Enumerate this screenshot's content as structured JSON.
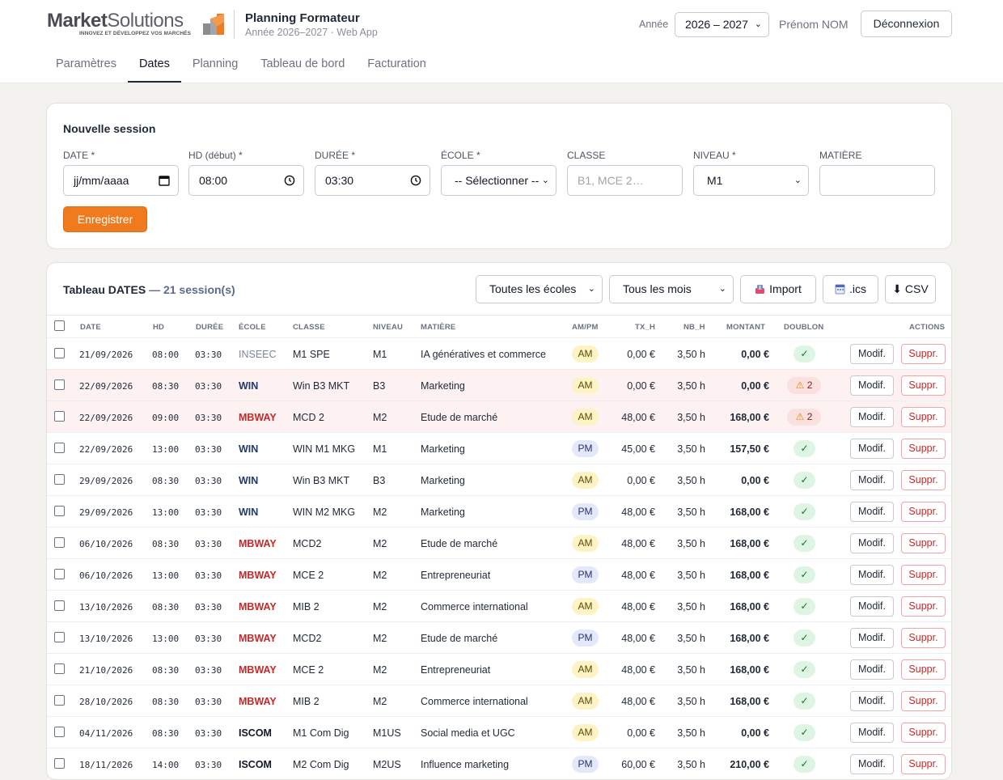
{
  "brand": {
    "logo_part1": "Market",
    "logo_part2": "Solutions",
    "logo_tagline": "INNOVEZ ET DÉVELOPPEZ VOS MARCHÉS",
    "app_title": "Planning Formateur",
    "app_subtitle": "Année 2026–2027 · Web App",
    "colors": {
      "accent": "#f07a1e",
      "logo_grey": "#5f6166"
    }
  },
  "header": {
    "year_label": "Année",
    "year_value": "2026 – 2027",
    "user_name": "Prénom NOM",
    "logout_label": "Déconnexion"
  },
  "nav": {
    "tabs": [
      {
        "label": "Paramètres",
        "active": false
      },
      {
        "label": "Dates",
        "active": true
      },
      {
        "label": "Planning",
        "active": false
      },
      {
        "label": "Tableau de bord",
        "active": false
      },
      {
        "label": "Facturation",
        "active": false
      }
    ]
  },
  "form": {
    "title": "Nouvelle session",
    "fields": {
      "date": {
        "label": "DATE *",
        "placeholder": "jj/mm/aaaa",
        "icon": "calendar-icon"
      },
      "hd": {
        "label": "HD (début) *",
        "value": "08:00",
        "icon": "clock-icon"
      },
      "duree": {
        "label": "DURÉE *",
        "value": "03:30",
        "icon": "clock-icon"
      },
      "ecole": {
        "label": "ÉCOLE *",
        "value": "-- Sélectionner --"
      },
      "classe": {
        "label": "CLASSE",
        "placeholder": "B1, MCE 2…"
      },
      "niveau": {
        "label": "NIVEAU *",
        "value": "M1"
      },
      "matiere": {
        "label": "MATIÈRE",
        "value": ""
      }
    },
    "save_label": "Enregistrer"
  },
  "table": {
    "title": "Tableau DATES",
    "count_label": "— 21 session(s)",
    "filters": {
      "ecoles": "Toutes les écoles",
      "mois": "Tous les mois"
    },
    "tools": {
      "import_label": "Import",
      "ics_label": ".ics",
      "csv_label": "CSV",
      "csv_prefix": "⬇"
    },
    "columns": [
      "DATE",
      "HD",
      "DURÉE",
      "ÉCOLE",
      "CLASSE",
      "NIVEAU",
      "MATIÈRE",
      "AM/PM",
      "TX_H",
      "NB_H",
      "MONTANT",
      "DOUBLON",
      "ACTIONS"
    ],
    "edit_label": "Modif.",
    "delete_label": "Suppr.",
    "ok_symbol": "✓",
    "warn_symbol": "⚠",
    "school_colors": {
      "INSEEC": "#7a8699",
      "WIN": "#1e3a6e",
      "MBWAY": "#c62828",
      "ISCOM": "#111827"
    },
    "rows": [
      {
        "date": "21/09/2026",
        "hd": "08:00",
        "duree": "03:30",
        "ecole": "INSEEC",
        "classe": "M1 SPE",
        "niveau": "M1",
        "matiere": "IA génératives et commerce",
        "ampm": "AM",
        "tx_h": "0,00 €",
        "nb_h": "3,50 h",
        "montant": "0,00 €",
        "doublon": "",
        "dup": false
      },
      {
        "date": "22/09/2026",
        "hd": "08:30",
        "duree": "03:30",
        "ecole": "WIN",
        "classe": "Win B3 MKT",
        "niveau": "B3",
        "matiere": "Marketing",
        "ampm": "AM",
        "tx_h": "0,00 €",
        "nb_h": "3,50 h",
        "montant": "0,00 €",
        "doublon": "2",
        "dup": true
      },
      {
        "date": "22/09/2026",
        "hd": "09:00",
        "duree": "03:30",
        "ecole": "MBWAY",
        "classe": "MCD 2",
        "niveau": "M2",
        "matiere": "Etude de marché",
        "ampm": "AM",
        "tx_h": "48,00 €",
        "nb_h": "3,50 h",
        "montant": "168,00 €",
        "doublon": "2",
        "dup": true
      },
      {
        "date": "22/09/2026",
        "hd": "13:00",
        "duree": "03:30",
        "ecole": "WIN",
        "classe": "WIN M1 MKG",
        "niveau": "M1",
        "matiere": "Marketing",
        "ampm": "PM",
        "tx_h": "45,00 €",
        "nb_h": "3,50 h",
        "montant": "157,50 €",
        "doublon": "",
        "dup": false
      },
      {
        "date": "29/09/2026",
        "hd": "08:30",
        "duree": "03:30",
        "ecole": "WIN",
        "classe": "Win B3 MKT",
        "niveau": "B3",
        "matiere": "Marketing",
        "ampm": "AM",
        "tx_h": "0,00 €",
        "nb_h": "3,50 h",
        "montant": "0,00 €",
        "doublon": "",
        "dup": false
      },
      {
        "date": "29/09/2026",
        "hd": "13:00",
        "duree": "03:30",
        "ecole": "WIN",
        "classe": "WIN M2 MKG",
        "niveau": "M2",
        "matiere": "Marketing",
        "ampm": "PM",
        "tx_h": "48,00 €",
        "nb_h": "3,50 h",
        "montant": "168,00 €",
        "doublon": "",
        "dup": false
      },
      {
        "date": "06/10/2026",
        "hd": "08:30",
        "duree": "03:30",
        "ecole": "MBWAY",
        "classe": "MCD2",
        "niveau": "M2",
        "matiere": "Etude de marché",
        "ampm": "AM",
        "tx_h": "48,00 €",
        "nb_h": "3,50 h",
        "montant": "168,00 €",
        "doublon": "",
        "dup": false
      },
      {
        "date": "06/10/2026",
        "hd": "13:00",
        "duree": "03:30",
        "ecole": "MBWAY",
        "classe": "MCE 2",
        "niveau": "M2",
        "matiere": "Entrepreneuriat",
        "ampm": "PM",
        "tx_h": "48,00 €",
        "nb_h": "3,50 h",
        "montant": "168,00 €",
        "doublon": "",
        "dup": false
      },
      {
        "date": "13/10/2026",
        "hd": "08:30",
        "duree": "03:30",
        "ecole": "MBWAY",
        "classe": "MIB 2",
        "niveau": "M2",
        "matiere": "Commerce international",
        "ampm": "AM",
        "tx_h": "48,00 €",
        "nb_h": "3,50 h",
        "montant": "168,00 €",
        "doublon": "",
        "dup": false
      },
      {
        "date": "13/10/2026",
        "hd": "13:00",
        "duree": "03:30",
        "ecole": "MBWAY",
        "classe": "MCD2",
        "niveau": "M2",
        "matiere": "Etude de marché",
        "ampm": "PM",
        "tx_h": "48,00 €",
        "nb_h": "3,50 h",
        "montant": "168,00 €",
        "doublon": "",
        "dup": false
      },
      {
        "date": "21/10/2026",
        "hd": "08:30",
        "duree": "03:30",
        "ecole": "MBWAY",
        "classe": "MCE 2",
        "niveau": "M2",
        "matiere": "Entrepreneuriat",
        "ampm": "AM",
        "tx_h": "48,00 €",
        "nb_h": "3,50 h",
        "montant": "168,00 €",
        "doublon": "",
        "dup": false
      },
      {
        "date": "28/10/2026",
        "hd": "08:30",
        "duree": "03:30",
        "ecole": "MBWAY",
        "classe": "MIB 2",
        "niveau": "M2",
        "matiere": "Commerce international",
        "ampm": "AM",
        "tx_h": "48,00 €",
        "nb_h": "3,50 h",
        "montant": "168,00 €",
        "doublon": "",
        "dup": false
      },
      {
        "date": "04/11/2026",
        "hd": "08:30",
        "duree": "03:30",
        "ecole": "ISCOM",
        "classe": "M1 Com Dig",
        "niveau": "M1US",
        "matiere": "Social media et UGC",
        "ampm": "AM",
        "tx_h": "0,00 €",
        "nb_h": "3,50 h",
        "montant": "0,00 €",
        "doublon": "",
        "dup": false
      },
      {
        "date": "18/11/2026",
        "hd": "14:00",
        "duree": "03:30",
        "ecole": "ISCOM",
        "classe": "M2 Com Dig",
        "niveau": "M2US",
        "matiere": "Influence marketing",
        "ampm": "PM",
        "tx_h": "60,00 €",
        "nb_h": "3,50 h",
        "montant": "210,00 €",
        "doublon": "",
        "dup": false
      }
    ]
  }
}
